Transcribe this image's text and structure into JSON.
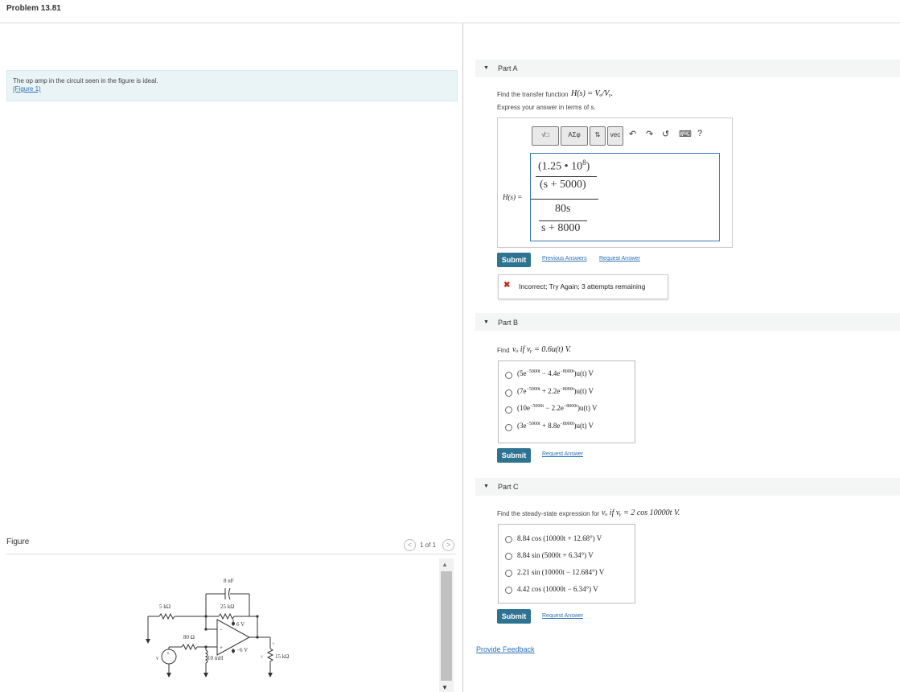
{
  "header": {
    "title": "Problem 13.81"
  },
  "left": {
    "intro_text": "The op amp in the circuit seen in the figure is ideal.",
    "figure_link": "(Figure 1)",
    "figure_label": "Figure",
    "pager": {
      "prev": "<",
      "next": ">",
      "count": "1 of 1"
    },
    "circuit": {
      "c1": "8 nF",
      "r1": "5 kΩ",
      "r2": "25 kΩ",
      "vplus": "6 V",
      "vminus": "−6 V",
      "r3": "80 Ω",
      "l1": "10 mH",
      "r4": "15 kΩ",
      "vg": "v",
      "vo": "v",
      "plus": "+",
      "minus": "−"
    }
  },
  "partA": {
    "title": "Part A",
    "prompt": "Find the transfer function",
    "prompt_math": "H(s) = Vₒ/Vᵧ.",
    "instruction": "Express your answer in terms of s.",
    "toolbar": {
      "t1": "√□",
      "t2": "ΑΣφ",
      "t3": "⇅",
      "t4": "vec",
      "undo": "↶",
      "redo": "↷",
      "reset": "↺",
      "keyboard": "⌨",
      "help": "?"
    },
    "lhs": "H(s) =",
    "num1": "(1.25 • 10",
    "num1_exp": "8",
    "num1_end": ")",
    "den1": "(s + 5000)",
    "num2": "80s",
    "den2": "s + 8000",
    "submit": "Submit",
    "prev_answers": "Previous Answers",
    "request_answer": "Request Answer",
    "feedback_icon": "✖",
    "feedback": "Incorrect; Try Again; 3 attempts remaining"
  },
  "partB": {
    "title": "Part B",
    "prompt": "Find",
    "prompt_math": "vₒ if vᵧ = 0.6u(t) V.",
    "options": [
      {
        "a": "(5e",
        "e1": "−5000t",
        "b": " − 4.4e",
        "e2": "−8000t",
        "c": ")u(t) V"
      },
      {
        "a": "(7e",
        "e1": "−5000t",
        "b": " + 2.2e",
        "e2": "−8000t",
        "c": ")u(t) V"
      },
      {
        "a": "(10e",
        "e1": "−5000t",
        "b": " − 2.2e",
        "e2": "−8000t",
        "c": ")u(t) V"
      },
      {
        "a": "(3e",
        "e1": "−5000t",
        "b": " + 8.8e",
        "e2": "−8000t",
        "c": ")u(t) V"
      }
    ],
    "submit": "Submit",
    "request_answer": "Request Answer"
  },
  "partC": {
    "title": "Part C",
    "prompt": "Find the steady-state expression for",
    "prompt_math": "vₒ if vᵧ = 2 cos 10000t V.",
    "options": [
      "8.84 cos (10000t + 12.68°) V",
      "8.84 sin (5000t + 6.34°) V",
      "2.21 sin (10000t − 12.684°) V",
      "4.42 cos (10000t − 6.34°) V"
    ],
    "submit": "Submit",
    "request_answer": "Request Answer"
  },
  "footer": {
    "provide_feedback": "Provide Feedback"
  }
}
